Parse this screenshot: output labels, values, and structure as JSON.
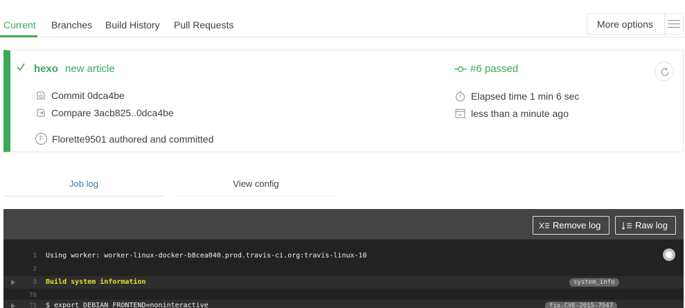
{
  "tabs": [
    {
      "label": "Current",
      "active": true
    },
    {
      "label": "Branches",
      "active": false
    },
    {
      "label": "Build History",
      "active": false
    },
    {
      "label": "Pull Requests",
      "active": false
    }
  ],
  "more_options": {
    "label": "More options",
    "icon": "hamburger-menu-icon"
  },
  "build": {
    "repo": "hexo",
    "message": "new article",
    "commit": "Commit 0dca4be",
    "compare": "Compare 3acb825..0dca4be",
    "author_initial": "F",
    "author": "Florette9501 authored and committed",
    "status": "#6 passed",
    "elapsed": "Elapsed time 1 min 6 sec",
    "finished": "less than a minute ago",
    "status_color": "#39aa56"
  },
  "log_tabs": [
    {
      "label": "Job log",
      "active": true
    },
    {
      "label": "View config",
      "active": false
    }
  ],
  "log_toolbar": {
    "remove_log": "Remove log",
    "raw_log": "Raw log"
  },
  "log_lines": [
    {
      "num": "1",
      "text": "Using worker: worker-linux-docker-b8cea040.prod.travis-ci.org:travis-linux-10",
      "fold": false,
      "highlight": false,
      "tag": ""
    },
    {
      "num": "2",
      "text": "",
      "fold": false,
      "highlight": false,
      "tag": ""
    },
    {
      "num": "3",
      "text": "Build system information",
      "fold": true,
      "highlight": true,
      "tag": "system_info"
    },
    {
      "num": "70",
      "text": "",
      "fold": false,
      "highlight": false,
      "tag": ""
    },
    {
      "num": "71",
      "text": "$ export DEBIAN_FRONTEND=noninteractive",
      "fold": true,
      "highlight": false,
      "tag": "fix.CVE-2015-7547"
    }
  ]
}
